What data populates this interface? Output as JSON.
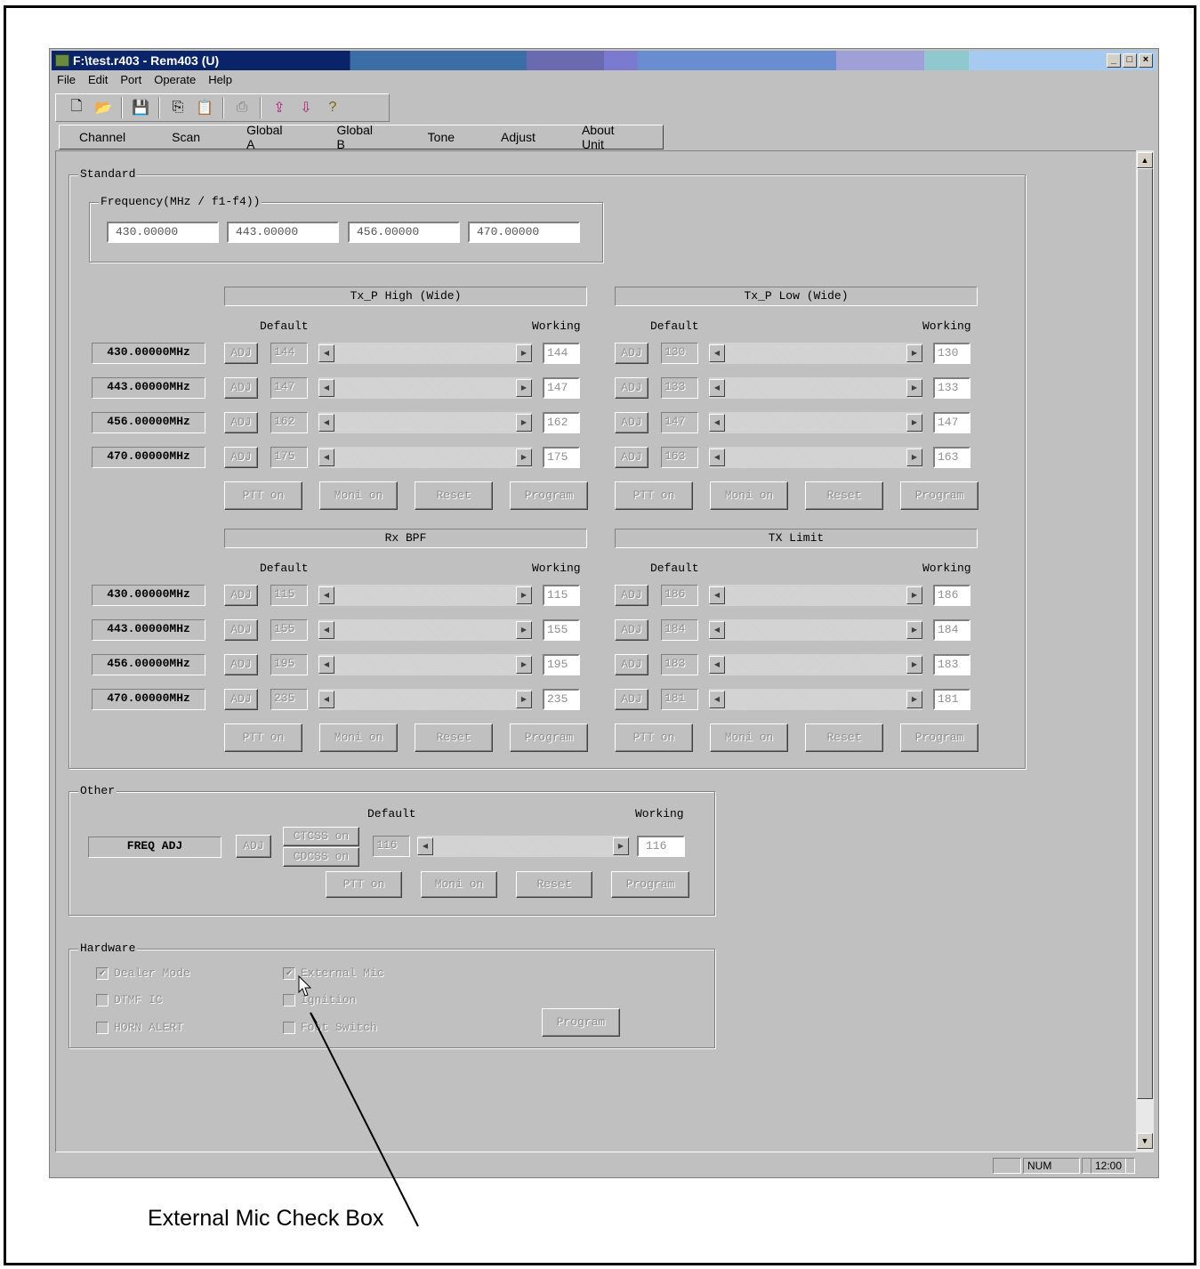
{
  "window": {
    "title": "F:\\test.r403 - Rem403 (U)",
    "min": "_",
    "max": "□",
    "close": "×"
  },
  "menu": [
    "File",
    "Edit",
    "Port",
    "Operate",
    "Help"
  ],
  "tabs": [
    "Channel",
    "Scan",
    "Global A",
    "Global B",
    "Tone",
    "Adjust",
    "About Unit"
  ],
  "standard": {
    "title": "Standard",
    "freq_group_title": "Frequency(MHz / f1-f4))",
    "freqs": [
      "430.00000",
      "443.00000",
      "456.00000",
      "470.00000"
    ],
    "row_labels": [
      "430.00000MHz",
      "443.00000MHz",
      "456.00000MHz",
      "470.00000MHz"
    ],
    "default_label": "Default",
    "working_label": "Working",
    "adj_label": "ADJ",
    "buttons": [
      "PTT on",
      "Moni on",
      "Reset",
      "Program"
    ],
    "panels": [
      {
        "title": "Tx_P High (Wide)",
        "defaults": [
          "144",
          "147",
          "162",
          "175"
        ],
        "working": [
          "144",
          "147",
          "162",
          "175"
        ]
      },
      {
        "title": "Tx_P Low  (Wide)",
        "defaults": [
          "130",
          "133",
          "147",
          "163"
        ],
        "working": [
          "130",
          "133",
          "147",
          "163"
        ]
      },
      {
        "title": "Rx BPF",
        "defaults": [
          "115",
          "155",
          "195",
          "235"
        ],
        "working": [
          "115",
          "155",
          "195",
          "235"
        ]
      },
      {
        "title": "TX Limit",
        "defaults": [
          "186",
          "184",
          "183",
          "181"
        ],
        "working": [
          "186",
          "184",
          "183",
          "181"
        ]
      }
    ]
  },
  "other": {
    "title": "Other",
    "label": "FREQ ADJ",
    "default_label": "Default",
    "working_label": "Working",
    "adj_label": "ADJ",
    "ctcss": "CTCSS on",
    "cdcss": "CDCSS on",
    "default": "116",
    "working": "116",
    "buttons": [
      "PTT on",
      "Moni on",
      "Reset",
      "Program"
    ]
  },
  "hardware": {
    "title": "Hardware",
    "checkboxes": [
      {
        "label": "Dealer Mode",
        "checked": true
      },
      {
        "label": "DTMF IC",
        "checked": false
      },
      {
        "label": "HORN ALERT",
        "checked": false
      },
      {
        "label": "External Mic",
        "checked": true
      },
      {
        "label": "Ignition",
        "checked": false
      },
      {
        "label": "Foot Switch",
        "checked": false
      }
    ],
    "program": "Program"
  },
  "status": {
    "num": "NUM",
    "time": "12:00"
  },
  "callout": "External Mic Check Box"
}
